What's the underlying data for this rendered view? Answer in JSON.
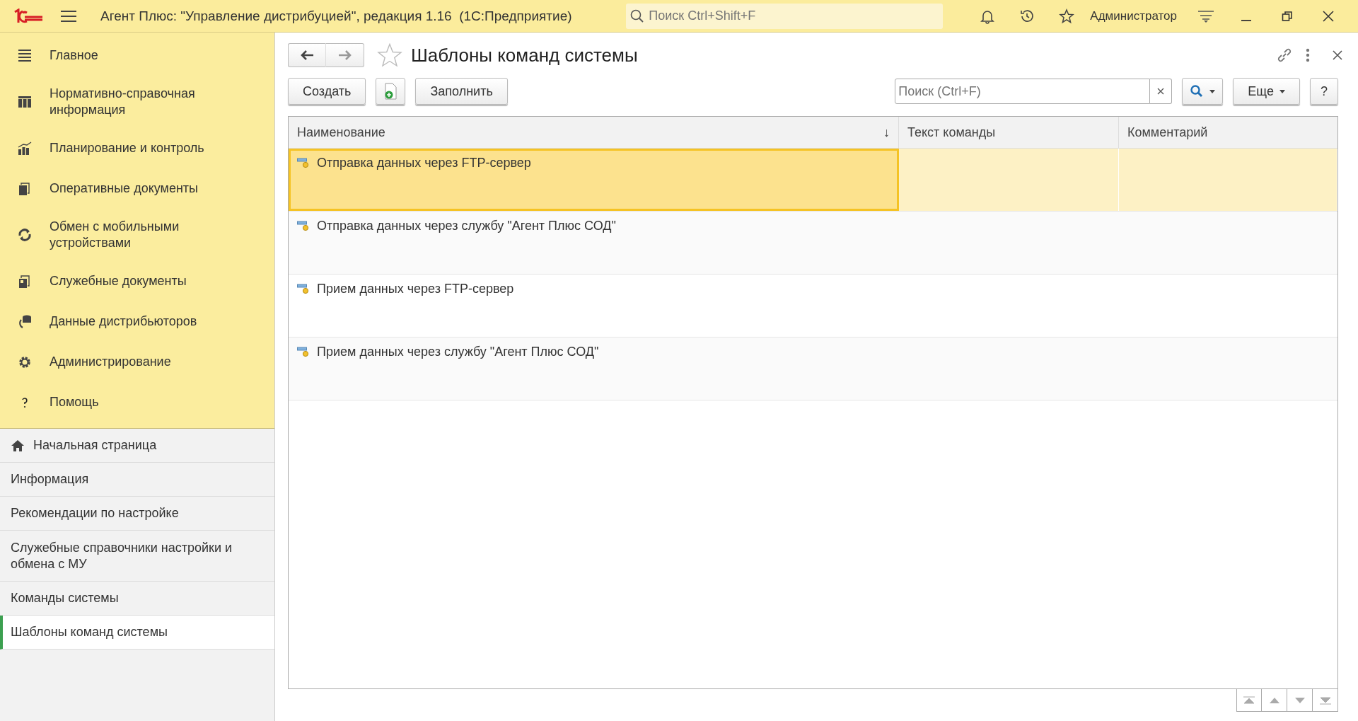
{
  "window": {
    "title": "Агент Плюс: \"Управление дистрибуцией\", редакция 1.16  (1С:Предприятие)",
    "search": {
      "placeholder": "Поиск Ctrl+Shift+F"
    },
    "user": "Администратор"
  },
  "sections": [
    {
      "label": "Главное",
      "kind": "menu"
    },
    {
      "label": "Нормативно-справочная информация",
      "kind": "catalog"
    },
    {
      "label": "Планирование и контроль",
      "kind": "chart"
    },
    {
      "label": "Оперативные документы",
      "kind": "docs"
    },
    {
      "label": "Обмен с мобильными устройствами",
      "kind": "sync"
    },
    {
      "label": "Служебные документы",
      "kind": "servicedocs"
    },
    {
      "label": "Данные дистрибьюторов",
      "kind": "data"
    },
    {
      "label": "Администрирование",
      "kind": "gear"
    },
    {
      "label": "Помощь",
      "kind": "help"
    }
  ],
  "nav": [
    {
      "label": "Начальная страница",
      "kind": "home",
      "selected": false
    },
    {
      "label": "Информация",
      "kind": "link",
      "selected": false
    },
    {
      "label": "Рекомендации по настройке",
      "kind": "link",
      "selected": false
    },
    {
      "label": "Служебные справочники настройки и обмена с МУ",
      "kind": "link",
      "selected": false
    },
    {
      "label": "Команды системы",
      "kind": "link",
      "selected": false
    },
    {
      "label": "Шаблоны команд системы",
      "kind": "link",
      "selected": true
    }
  ],
  "form": {
    "title": "Шаблоны команд системы",
    "buttons": {
      "create": "Создать",
      "fill": "Заполнить",
      "more": "Еще",
      "help": "?"
    },
    "search": {
      "placeholder": "Поиск (Ctrl+F)"
    }
  },
  "table": {
    "columns": [
      {
        "label": "Наименование",
        "sort": "↓"
      },
      {
        "label": "Текст команды"
      },
      {
        "label": "Комментарий"
      }
    ],
    "rows": [
      {
        "name": "Отправка данных через FTP-сервер",
        "selected": true
      },
      {
        "name": "Отправка данных через службу \"Агент Плюс СОД\"",
        "selected": false
      },
      {
        "name": "Прием данных через FTP-сервер",
        "selected": false
      },
      {
        "name": "Прием данных через службу \"Агент Плюс СОД\"",
        "selected": false
      }
    ]
  }
}
